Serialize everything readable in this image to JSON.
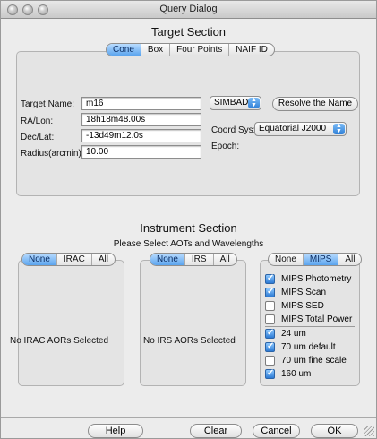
{
  "window": {
    "title": "Query Dialog"
  },
  "target": {
    "heading": "Target Section",
    "tabs": [
      "Cone",
      "Box",
      "Four Points",
      "NAIF ID"
    ],
    "target_name_label": "Target Name:",
    "target_name_value": "m16",
    "ra_label": "RA/Lon:",
    "ra_value": "18h18m48.00s",
    "dec_label": "Dec/Lat:",
    "dec_value": "-13d49m12.0s",
    "radius_label": "Radius(arcmin):",
    "radius_value": "10.00",
    "resolver": "SIMBAD",
    "resolve_button": "Resolve the Name",
    "coord_sys_label": "Coord Sys:",
    "coord_sys_value": "Equatorial J2000",
    "epoch_label": "Epoch:"
  },
  "instrument": {
    "heading": "Instrument Section",
    "subheading": "Please Select AOTs and Wavelengths",
    "irac": {
      "tabs": [
        "None",
        "IRAC",
        "All"
      ],
      "empty": "No IRAC AORs Selected"
    },
    "irs": {
      "tabs": [
        "None",
        "IRS",
        "All"
      ],
      "empty": "No IRS AORs Selected"
    },
    "mips": {
      "tabs": [
        "None",
        "MIPS",
        "All"
      ],
      "aots": [
        {
          "label": "MIPS Photometry",
          "checked": true
        },
        {
          "label": "MIPS Scan",
          "checked": true
        },
        {
          "label": "MIPS SED",
          "checked": false
        },
        {
          "label": "MIPS Total Power",
          "checked": false
        }
      ],
      "wavelengths": [
        {
          "label": "24 um",
          "checked": true
        },
        {
          "label": "70 um default",
          "checked": true
        },
        {
          "label": "70 um fine scale",
          "checked": false
        },
        {
          "label": "160 um",
          "checked": true
        }
      ]
    }
  },
  "buttons": {
    "help": "Help",
    "clear": "Clear",
    "cancel": "Cancel",
    "ok": "OK"
  }
}
